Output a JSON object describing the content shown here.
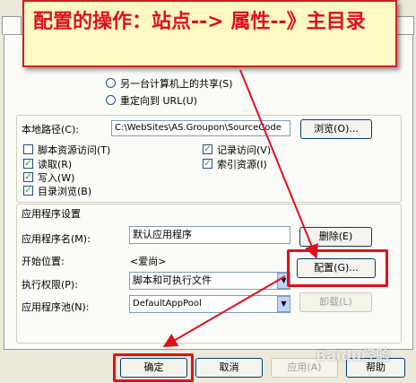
{
  "callout": {
    "text": "配置的操作：站点--> 属性--》主目录"
  },
  "radios": [
    {
      "label": "另一台计算机上的共享(S)"
    },
    {
      "label": "重定向到 URL(U)"
    }
  ],
  "local_path": {
    "label": "本地路径(C):",
    "value": "C:\\WebSites\\AS.Groupon\\SourceCode",
    "browse": "浏览(O)..."
  },
  "checkboxes": [
    {
      "label": "脚本资源访问(T)",
      "checked": false
    },
    {
      "label": "读取(R)",
      "checked": true
    },
    {
      "label": "写入(W)",
      "checked": true
    },
    {
      "label": "目录浏览(B)",
      "checked": true
    },
    {
      "label": "记录访问(V)",
      "checked": true
    },
    {
      "label": "索引资源(I)",
      "checked": true
    }
  ],
  "app_settings": {
    "heading": "应用程序设置",
    "name_label": "应用程序名(M):",
    "name_value": "默认应用程序",
    "remove": "删除(E)",
    "start_label": "开始位置:",
    "start_value": "<爱尚>",
    "config": "配置(G)...",
    "exec_label": "执行权限(P):",
    "exec_value": "脚本和可执行文件",
    "pool_label": "应用程序池(N):",
    "pool_value": "DefaultAppPool",
    "unload": "卸载(L)"
  },
  "footer": {
    "ok": "确定",
    "cancel": "取消",
    "apply": "应用(A)",
    "help": "帮助"
  },
  "watermark": "Baidu经验",
  "colors": {
    "dialog_bg": "#ece9d8",
    "highlight": "#e0101c",
    "callout_bg": "#fff9c4"
  }
}
